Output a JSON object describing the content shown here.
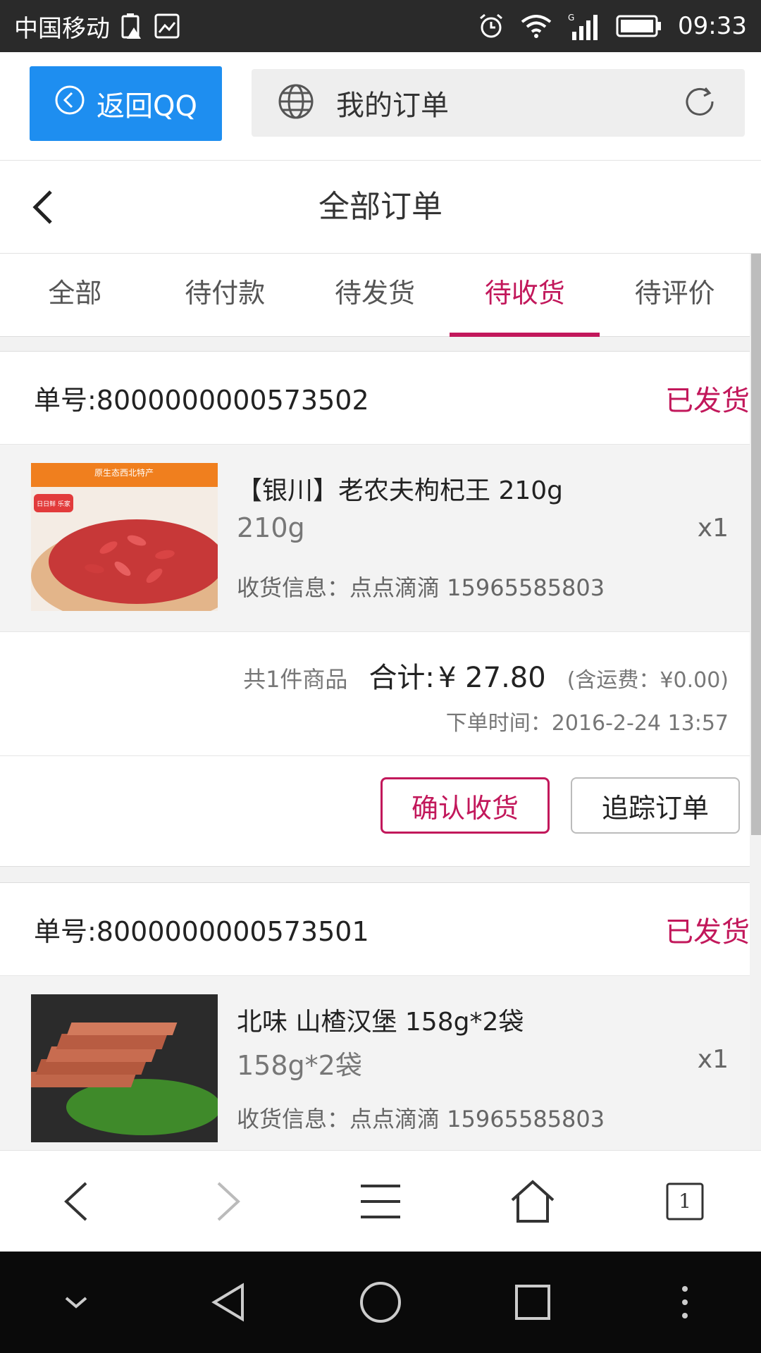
{
  "status_bar": {
    "carrier": "中国移动",
    "time": "09:33",
    "icons": [
      "battery-warning-icon",
      "image-icon",
      "alarm-icon",
      "wifi-icon",
      "signal-icon",
      "battery-icon"
    ]
  },
  "browser": {
    "back_label": "返回QQ",
    "page_title": "我的订单",
    "accent": "#1e8ef0"
  },
  "header": {
    "title": "全部订单"
  },
  "tabs": [
    {
      "label": "全部",
      "active": false
    },
    {
      "label": "待付款",
      "active": false
    },
    {
      "label": "待发货",
      "active": false
    },
    {
      "label": "待收货",
      "active": true
    },
    {
      "label": "待评价",
      "active": false
    }
  ],
  "orders": [
    {
      "order_no": "单号:8000000000573502",
      "status": "已发货",
      "item": {
        "image_caption": "原生态西北特产",
        "image_badge": "日日鲜 乐家",
        "name": "【银川】老农夫枸杞王 210g",
        "spec": "210g",
        "qty": "x1",
        "receiver": "收货信息：点点滴滴 15965585803"
      },
      "count": "共1件商品",
      "total_label": "合计:",
      "total": "¥ 27.80",
      "shipping": "(含运费：¥0.00)",
      "order_time": "下单时间：2016-2-24 13:57",
      "confirm_label": "确认收货",
      "track_label": "追踪订单"
    },
    {
      "order_no": "单号:8000000000573501",
      "status": "已发货",
      "item": {
        "name": "北味 山楂汉堡 158g*2袋",
        "spec": "158g*2袋",
        "qty": "x1",
        "receiver": "收货信息：点点滴滴 15965585803"
      }
    }
  ],
  "toolbar": {
    "tab_count": "1"
  },
  "colors": {
    "active_tab": "#c2185b",
    "status": "#c2185b"
  }
}
